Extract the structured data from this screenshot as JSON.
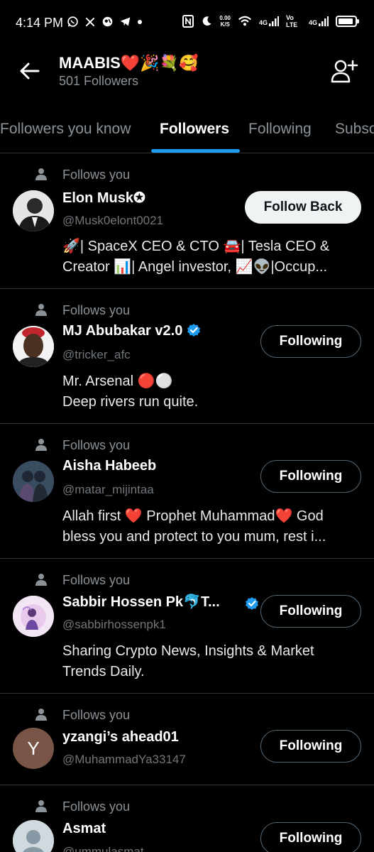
{
  "status_bar": {
    "time": "4:14 PM",
    "left_icons": [
      "whatsapp-icon",
      "x-icon",
      "app-icon",
      "telegram-icon",
      "dot-icon"
    ],
    "network_speed": "0.00",
    "network_unit": "K/S",
    "signal_1": "4G",
    "volte": "Vo LTE",
    "signal_2": "4G"
  },
  "header": {
    "title": "MAABIS❤️🎉💐🥰",
    "subtitle": "501 Followers"
  },
  "tabs": [
    {
      "label": "Followers you know",
      "active": false
    },
    {
      "label": "Followers",
      "active": true
    },
    {
      "label": "Following",
      "active": false
    },
    {
      "label": "Subscriptions",
      "active": false
    }
  ],
  "accent_color": "#1d9bf0",
  "rows": [
    {
      "follows_you": "Follows you",
      "name": "Elon Musk✪",
      "handle": "@Musk0elont0021",
      "button": "Follow Back",
      "bio": [
        "🚀| SpaceX CEO & CTO 🚘| Tesla CEO &",
        "Creator 📊| Angel investor, 📈👽|Occup..."
      ]
    },
    {
      "follows_you": "Follows you",
      "name": "MJ Abubakar v2.0",
      "handle": "@tricker_afc",
      "button": "Following",
      "bio": [
        "Mr. Arsenal 🔴⚪",
        "Deep rivers run quite."
      ]
    },
    {
      "follows_you": "Follows you",
      "name": "Aisha Habeeb",
      "handle": "@matar_mijintaa",
      "button": "Following",
      "bio": [
        "Allah first ❤️ Prophet Muhammad❤️  God",
        "bless you and protect to you mum, rest i..."
      ]
    },
    {
      "follows_you": "Follows you",
      "name": "Sabbir Hossen Pk🐬T...",
      "handle": "@sabbirhossenpk1",
      "button": "Following",
      "bio": [
        "Sharing Crypto News, Insights & Market",
        "Trends Daily."
      ]
    },
    {
      "follows_you": "Follows you",
      "name": "yzangi’s ahead01",
      "handle": "@MuhammadYa33147",
      "button": "Following",
      "avatar_letter": "Y"
    },
    {
      "follows_you": "Follows you",
      "name": "Asmat",
      "handle": "@ummulasmat",
      "button": "Following"
    }
  ]
}
